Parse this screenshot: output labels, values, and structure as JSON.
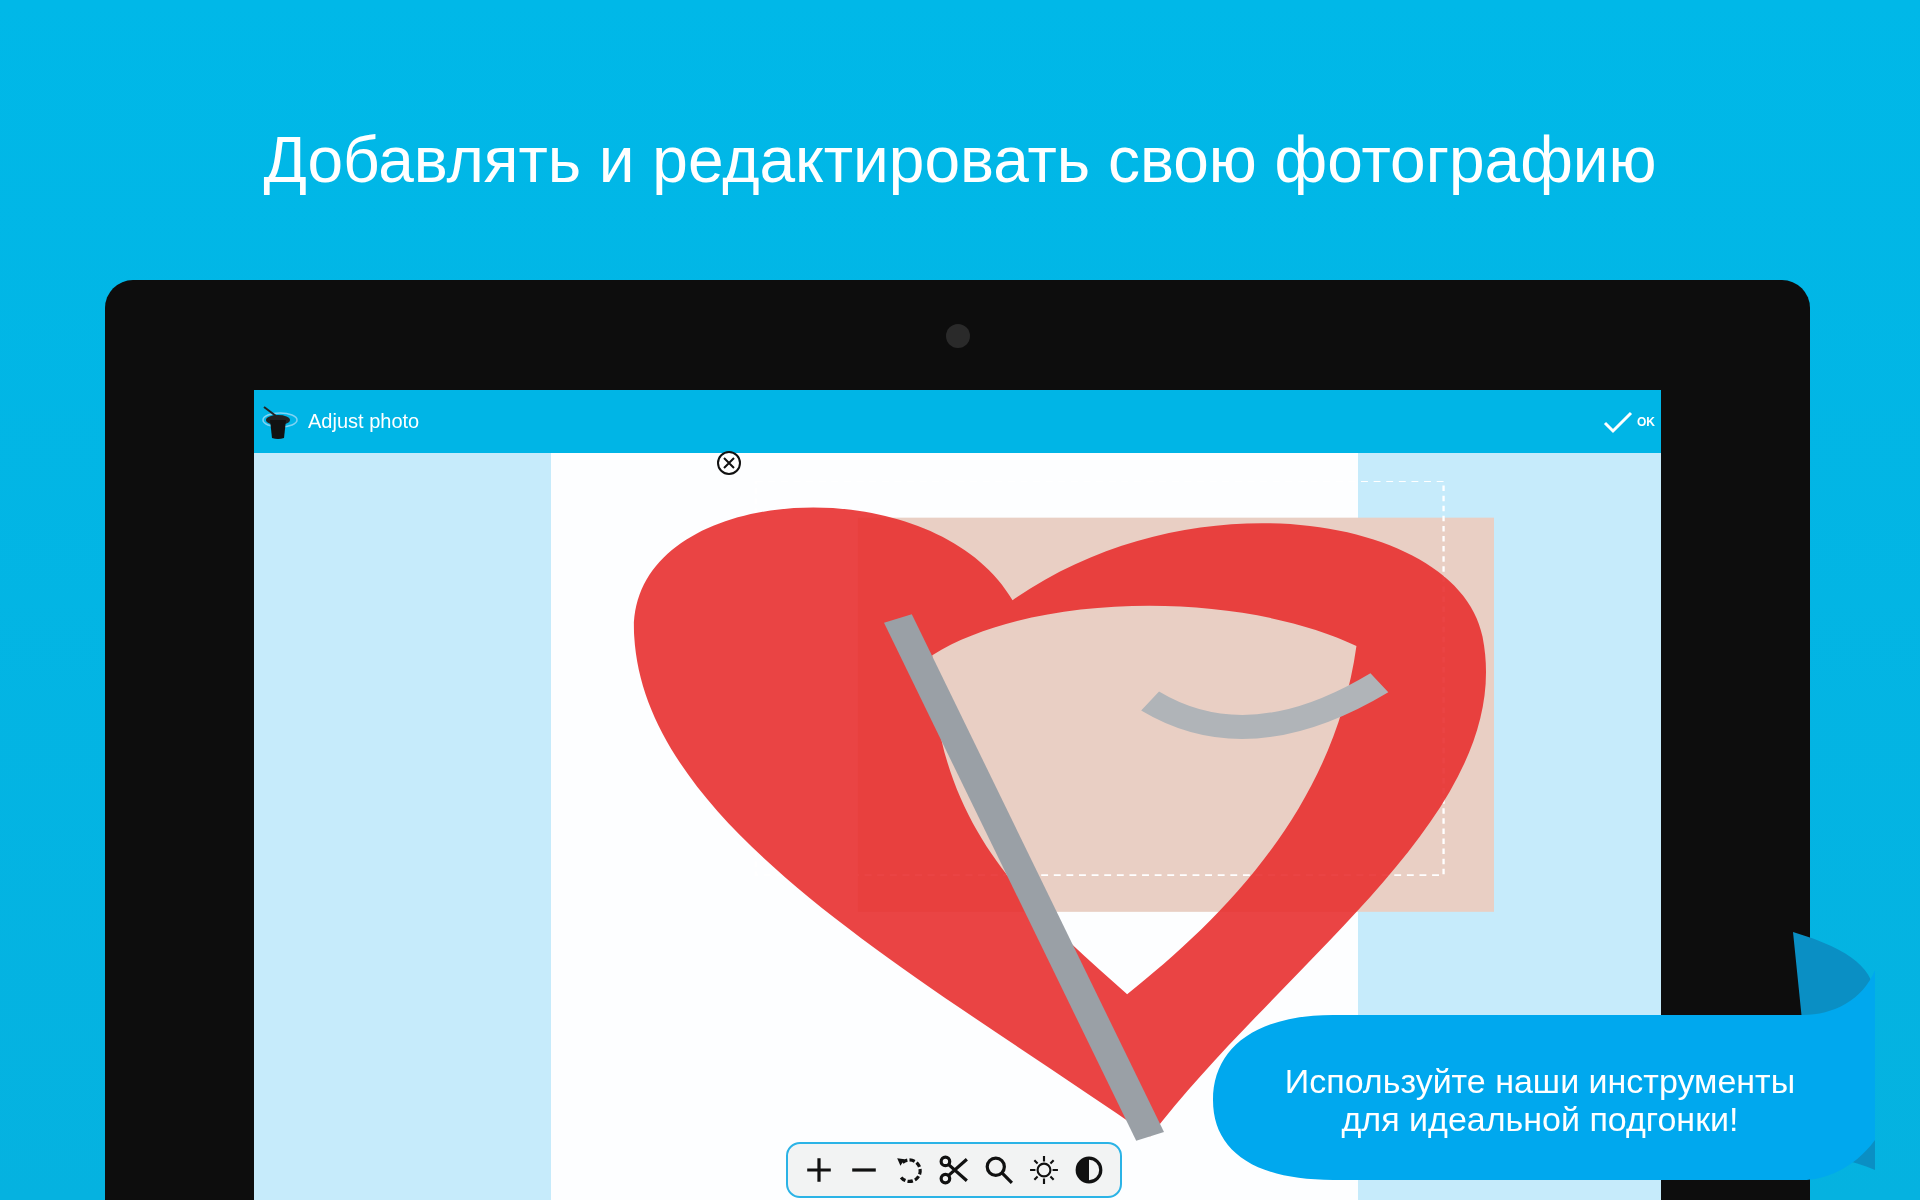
{
  "headline": "Добавлять и редактировать свою фотографию",
  "app_bar": {
    "title": "Adjust photo",
    "confirm": "OK"
  },
  "toolbar": [
    {
      "kind": "plus"
    },
    {
      "kind": "minus"
    },
    {
      "kind": "rotate"
    },
    {
      "kind": "cut"
    },
    {
      "kind": "zoom"
    },
    {
      "kind": "brightness"
    },
    {
      "kind": "contrast"
    }
  ],
  "callout": "Используйте наши инструменты\nдля идеальной подгонки!"
}
